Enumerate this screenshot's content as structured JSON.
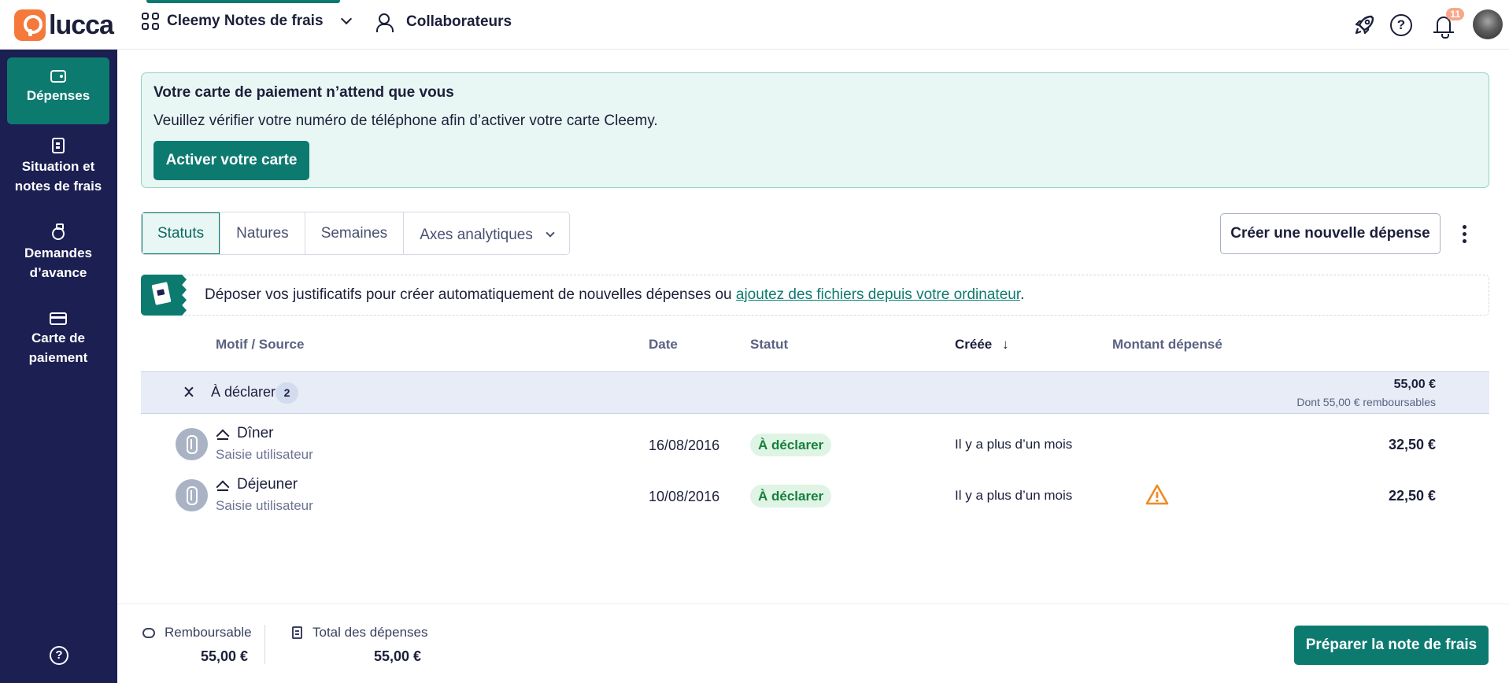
{
  "header": {
    "logo": "lucca",
    "app_name": "Cleemy Notes de frais",
    "collaborators": "Collaborateurs",
    "notification_count": "11",
    "help_glyph": "?"
  },
  "sidebar": {
    "items": [
      {
        "label": "Dépenses",
        "icon": "wallet-icon"
      },
      {
        "label": "Situation et notes de frais",
        "icon": "document-icon"
      },
      {
        "label": "Demandes d’avance",
        "icon": "ring-icon"
      },
      {
        "label": "Carte de paiement",
        "icon": "card-icon"
      }
    ],
    "help_glyph": "?"
  },
  "banner": {
    "title": "Votre carte de paiement n’attend que vous",
    "text": "Veuillez vérifier votre numéro de téléphone afin d’activer votre carte Cleemy.",
    "button": "Activer votre carte"
  },
  "tabs": [
    "Statuts",
    "Natures",
    "Semaines",
    "Axes analytiques"
  ],
  "new_expense_button": "Créer une nouvelle dépense",
  "dropzone": {
    "text": "Déposer vos justificatifs pour créer automatiquement de nouvelles dépenses ou ",
    "link": "ajoutez des fichiers depuis votre ordinateur",
    "suffix": "."
  },
  "table": {
    "columns": [
      "Motif / Source",
      "Date",
      "Statut",
      "Créée",
      "Montant dépensé"
    ],
    "sort_arrow": "↓",
    "group": {
      "label": "À déclarer",
      "count": "2",
      "total": "55,00 €",
      "subtotal": "Dont 55,00 € remboursables"
    },
    "rows": [
      {
        "title": "Dîner",
        "source": "Saisie utilisateur",
        "date": "16/08/2016",
        "status": "À déclarer",
        "created": "Il y a plus d’un mois",
        "amount": "32,50 €",
        "warning": false
      },
      {
        "title": "Déjeuner",
        "source": "Saisie utilisateur",
        "date": "10/08/2016",
        "status": "À déclarer",
        "created": "Il y a plus d’un mois",
        "amount": "22,50 €",
        "warning": true
      }
    ]
  },
  "footer": {
    "refundable_label": "Remboursable",
    "refundable_value": "55,00 €",
    "total_label": "Total des dépenses",
    "total_value": "55,00 €",
    "prepare_button": "Préparer la note de frais"
  },
  "colors": {
    "primary": "#0d7a70",
    "sidebar": "#1c1f52",
    "warning": "#f08a24",
    "status_bg": "#dff4e4"
  }
}
